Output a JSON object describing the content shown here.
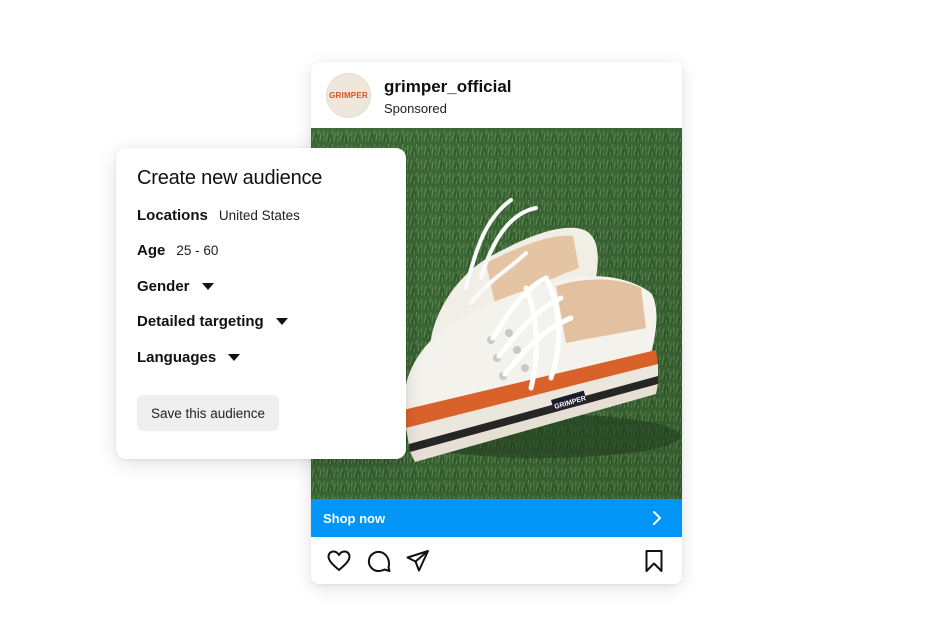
{
  "post": {
    "account": {
      "avatar_text": "GRIMPER",
      "username": "grimper_official",
      "sponsored_label": "Sponsored"
    },
    "image": {
      "subject": "white platform sneakers with orange trim on green grass",
      "shoe_brand_text": "GRIMPER"
    },
    "cta": {
      "label": "Shop now",
      "color": "#0095f6",
      "icon": "chevron-right-icon"
    },
    "actions": {
      "icons": [
        "heart-icon",
        "comment-icon",
        "share-icon",
        "bookmark-icon"
      ]
    }
  },
  "audience_panel": {
    "title": "Create new audience",
    "locations": {
      "label": "Locations",
      "value": "United States"
    },
    "age": {
      "label": "Age",
      "value": "25 - 60"
    },
    "gender": {
      "label": "Gender",
      "icon": "caret-down-icon"
    },
    "detailed_targeting": {
      "label": "Detailed targeting",
      "icon": "caret-down-icon"
    },
    "languages": {
      "label": "Languages",
      "icon": "caret-down-icon"
    },
    "save_button_label": "Save this audience"
  }
}
